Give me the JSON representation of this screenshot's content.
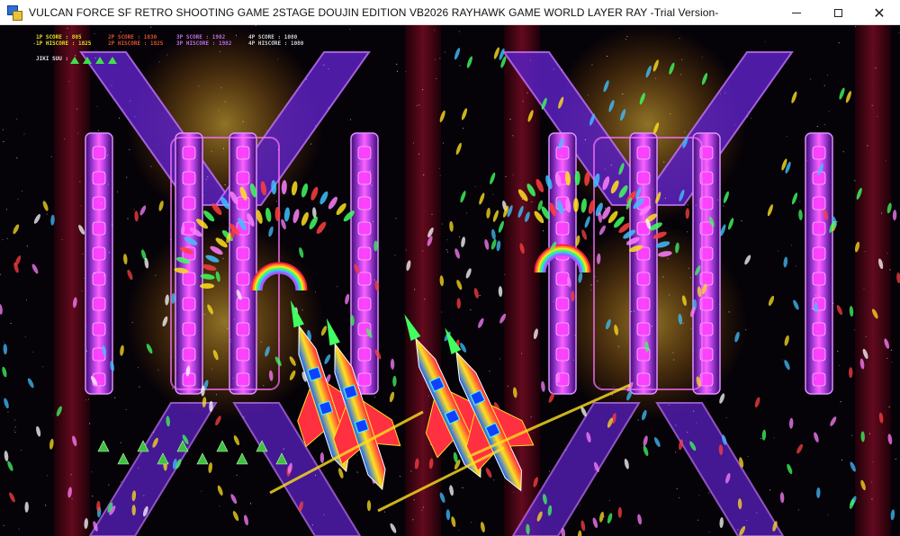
{
  "window": {
    "title": "VULCAN FORCE SF RETRO SHOOTING GAME 2STAGE DOUJIN EDITION VB2026 RAYHAWK GAME WORLD LAYER RAY -Trial Version-",
    "minimize_glyph": "",
    "maximize_glyph": "",
    "close_glyph": "✕"
  },
  "hud": {
    "p1_score_label": "1P SCORE : 805",
    "p1_hiscore_label": "1P HISCORE : 1825",
    "p2_score_label": "2P SCORE : 1830",
    "p2_hiscore_label": "2P HISCORE : 1825",
    "p3_score_label": "3P SCORE : 1982",
    "p3_hiscore_label": "3P HISCORE : 1982",
    "p4_score_label": "4P SCORE : 1080",
    "p4_hiscore_label": "4P HISCORE : 1080",
    "lives_label": "JIKI SUU :",
    "lives_count": 4
  },
  "colors": {
    "p1": "#e8e020",
    "p2": "#e05030",
    "p3": "#c070e0",
    "p4": "#d0d0d0",
    "lives": "#3fe04a",
    "pillar": "#b040e0",
    "pillar_core": "#ff40ff",
    "background": "#050208"
  }
}
